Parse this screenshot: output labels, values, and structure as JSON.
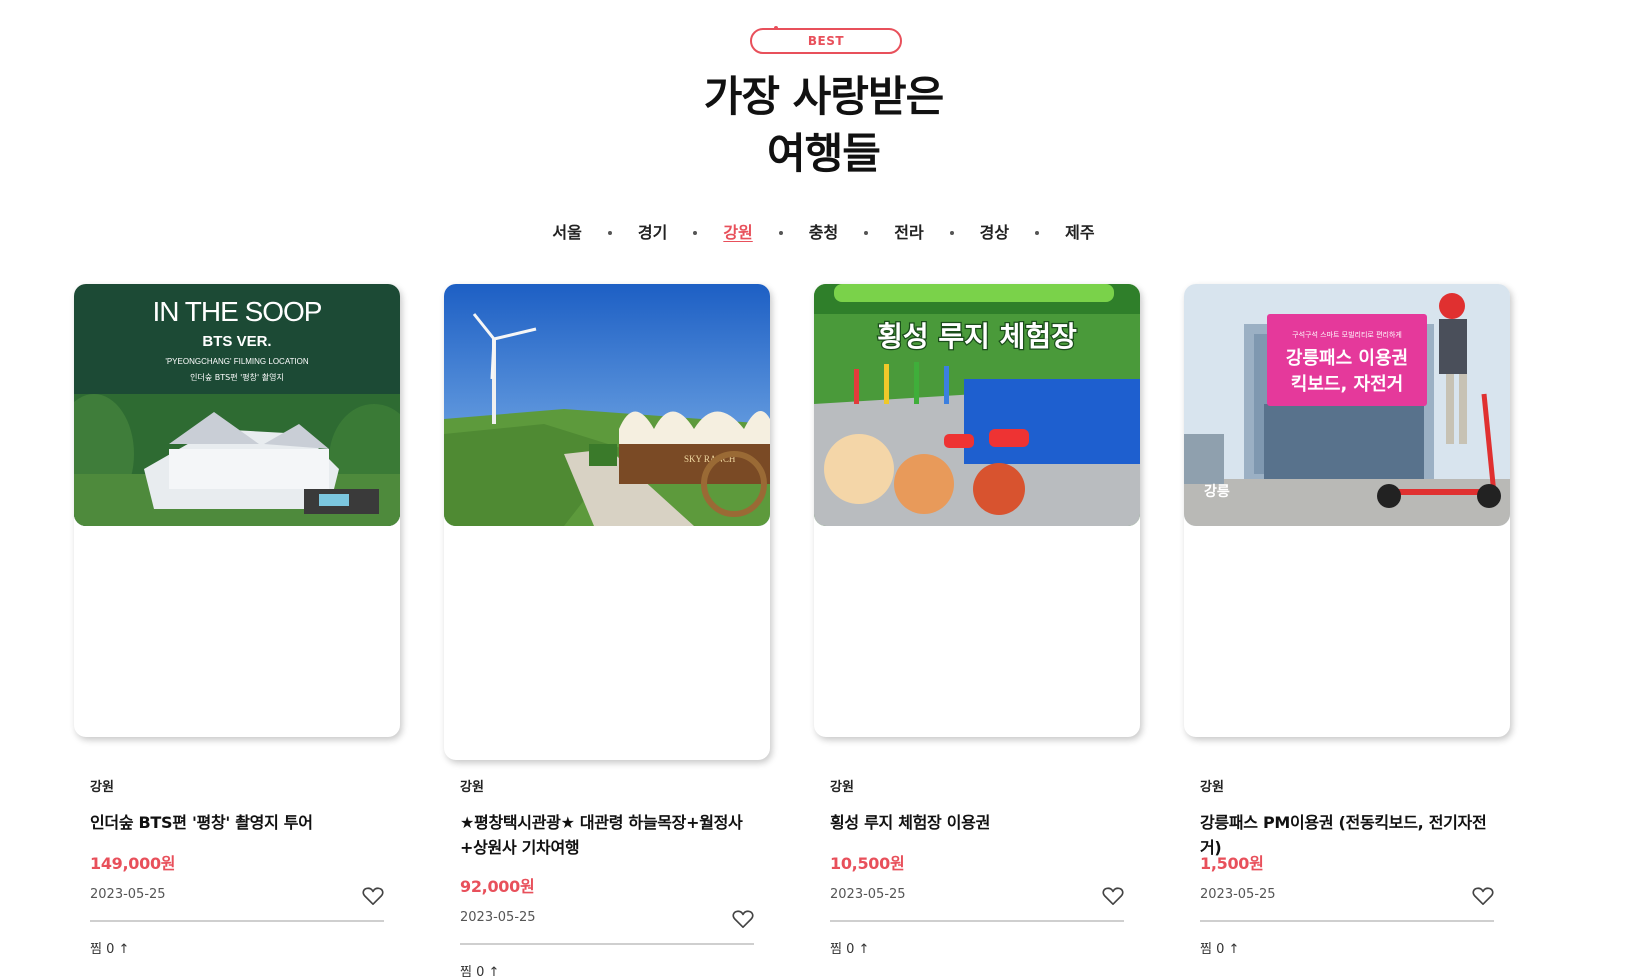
{
  "section": {
    "badge": "BEST",
    "title_line1": "가장 사랑받은",
    "title_line2": "여행들"
  },
  "regions": [
    {
      "label": "서울",
      "active": false
    },
    {
      "label": "경기",
      "active": false
    },
    {
      "label": "강원",
      "active": true
    },
    {
      "label": "충청",
      "active": false
    },
    {
      "label": "전라",
      "active": false
    },
    {
      "label": "경상",
      "active": false
    },
    {
      "label": "제주",
      "active": false
    }
  ],
  "colors": {
    "accent": "#e8505b"
  },
  "cards": [
    {
      "region": "강원",
      "title": "인더숲 BTS편 '평창' 촬영지 투어",
      "price": "149,000원",
      "date": "2023-05-25",
      "likes": "찜 0 ↑",
      "image_text": {
        "line1": "IN THE SOOP",
        "line2": "BTS VER.",
        "line3": "'PYEONGCHANG' FILMING LOCATION",
        "line4": "인더숲 BTS편 '평창' 촬영지"
      }
    },
    {
      "region": "강원",
      "title": "★평창택시관광★ 대관령 하늘목장+월정사+상원사 기차여행",
      "price": "92,000원",
      "date": "2023-05-25",
      "likes": "찜 0 ↑",
      "image_text": {
        "sign": "SKY RANCH"
      }
    },
    {
      "region": "강원",
      "title": "횡성 루지 체험장 이용권",
      "price": "10,500원",
      "date": "2023-05-25",
      "likes": "찜 0 ↑",
      "image_text": {
        "line1": "횡성 루지 체험장"
      }
    },
    {
      "region": "강원",
      "title": "강릉패스 PM이용권 (전동킥보드, 전기자전거)",
      "price": "1,500원",
      "date": "2023-05-25",
      "likes": "찜 0 ↑",
      "image_text": {
        "small": "구석구석 스마트 모빌리티로 편리하게",
        "line1": "강릉패스 이용권",
        "line2": "킥보드, 자전거",
        "logo": "강릉"
      }
    }
  ]
}
